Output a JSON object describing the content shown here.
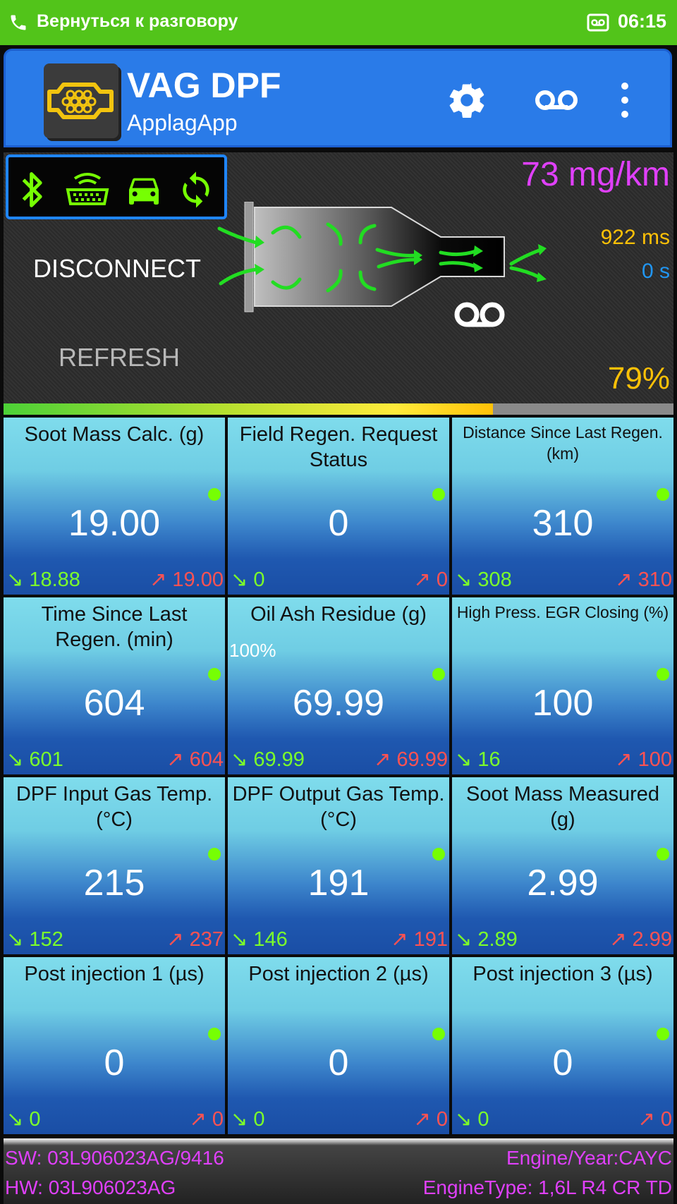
{
  "status_bar": {
    "back_text": "Вернуться к разговору",
    "time": "06:15"
  },
  "app": {
    "title": "VAG DPF",
    "subtitle": "ApplagApp"
  },
  "hero": {
    "status_icons": [
      "bluetooth-icon",
      "obd-connector-icon",
      "car-icon",
      "sync-icon"
    ],
    "disconnect_label": "DISCONNECT",
    "refresh_label": "REFRESH",
    "emission": "73 mg/km",
    "response_time": "922 ms",
    "elapsed": "0 s",
    "fill_percent_text": "79%",
    "fill_fraction": 0.73
  },
  "tiles": [
    {
      "title": "Soot Mass Calc. (g)",
      "value": "19.00",
      "min": "18.88",
      "max": "19.00",
      "small": false
    },
    {
      "title": "Field Regen. Request Status",
      "value": "0",
      "min": "0",
      "max": "0",
      "small": false
    },
    {
      "title": "Distance Since Last Regen. (km)",
      "value": "310",
      "min": "308",
      "max": "310",
      "small": true
    },
    {
      "title": "Time Since Last Regen. (min)",
      "value": "604",
      "min": "601",
      "max": "604",
      "small": false
    },
    {
      "title": "Oil Ash Residue (g)",
      "value": "69.99",
      "min": "69.99",
      "max": "69.99",
      "small": false,
      "extra": "100%"
    },
    {
      "title": "High Press. EGR Closing (%)",
      "value": "100",
      "min": "16",
      "max": "100",
      "small": true
    },
    {
      "title": "DPF Input Gas Temp. (°C)",
      "value": "215",
      "min": "152",
      "max": "237",
      "small": false
    },
    {
      "title": "DPF Output Gas Temp. (°C)",
      "value": "191",
      "min": "146",
      "max": "191",
      "small": false
    },
    {
      "title": "Soot Mass Measured (g)",
      "value": "2.99",
      "min": "2.89",
      "max": "2.99",
      "small": false
    },
    {
      "title": "Post injection 1 (µs)",
      "value": "0",
      "min": "0",
      "max": "0",
      "small": false
    },
    {
      "title": "Post injection 2 (µs)",
      "value": "0",
      "min": "0",
      "max": "0",
      "small": false
    },
    {
      "title": "Post injection 3 (µs)",
      "value": "0",
      "min": "0",
      "max": "0",
      "small": false
    }
  ],
  "footer": {
    "sw": "SW: 03L906023AG/9416",
    "hw": "HW: 03L906023AG",
    "engine_year": "Engine/Year:CAYC",
    "engine_type": "EngineType: 1,6L R4 CR TD"
  },
  "colors": {
    "status_bar": "#52c41a",
    "app_bar": "#2a7be8",
    "accent_green": "#76ff03",
    "min_color": "#7cff2a",
    "max_color": "#ff5252",
    "emission": "#e040fb",
    "amber": "#ffc107"
  }
}
